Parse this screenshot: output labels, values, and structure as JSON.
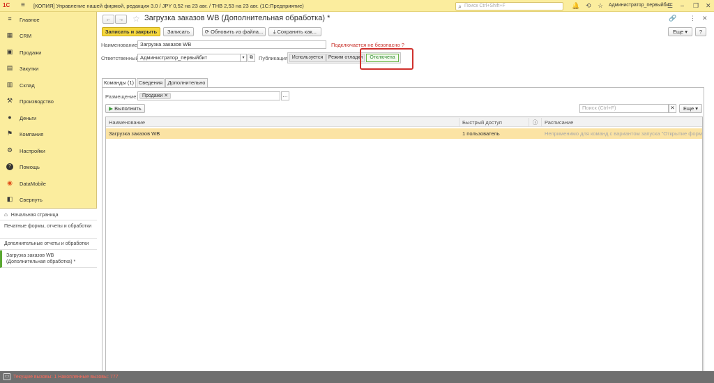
{
  "app": {
    "window_title": "[КОПИЯ] Управление нашей фирмой, редакция 3.0 / JPY 0,52 на 23 авг. / THB 2,53 на 23 авг.  (1С:Предприятие)",
    "logo": "1С",
    "search_placeholder": "Поиск Ctrl+Shift+F",
    "user": "Администратор_первыйбит"
  },
  "sidebar": {
    "items": [
      {
        "label": "Главное",
        "icon": "≡"
      },
      {
        "label": "CRM",
        "icon": "▦"
      },
      {
        "label": "Продажи",
        "icon": "🛍"
      },
      {
        "label": "Закупки",
        "icon": "▤"
      },
      {
        "label": "Склад",
        "icon": "▥"
      },
      {
        "label": "Производство",
        "icon": "⚒"
      },
      {
        "label": "Деньги",
        "icon": "●"
      },
      {
        "label": "Компания",
        "icon": "⚑"
      },
      {
        "label": "Настройки",
        "icon": "⚙"
      },
      {
        "label": "Помощь",
        "icon": "?"
      },
      {
        "label": "DataMobile",
        "icon": "◉"
      },
      {
        "label": "Свернуть",
        "icon": "◧"
      }
    ],
    "home_label": "Начальная страница",
    "open_items": [
      "Печатные формы, отчеты и обработки",
      "Дополнительные отчеты и обработки",
      "Загрузка заказов WB (Дополнительная обработка) *"
    ]
  },
  "form": {
    "title": "Загрузка заказов WB (Дополнительная обработка) *",
    "toolbar": {
      "save_close": "Записать и закрыть",
      "save": "Записать",
      "update_from_file": "Обновить из файла...",
      "save_as": "Сохранить как...",
      "more": "Еще",
      "help": "?"
    },
    "name_label": "Наименование:",
    "name_value": "Загрузка заказов WB",
    "unsafe_link": "Подключается не безопасно",
    "unsafe_q": "?",
    "responsible_label": "Ответственный:",
    "responsible_value": "Администратор_первыйбит",
    "publication_label": "Публикация:",
    "publication_options": [
      "Используется",
      "Режим отладки",
      "Отключена"
    ],
    "tabs": [
      "Команды (1)",
      "Сведения",
      "Дополнительно"
    ],
    "placement_label": "Размещение:",
    "placement_tag": "Продажи",
    "run_button": "Выполнить",
    "search_placeholder": "Поиск (Ctrl+F)",
    "more2": "Еще",
    "table": {
      "headers": [
        "Наименование",
        "Быстрый доступ",
        "Расписание"
      ],
      "rows": [
        {
          "name": "Загрузка заказов WB",
          "access": "1 пользователь",
          "schedule": "Неприменимо для команд с вариантом запуска \"Открытие формы\""
        }
      ]
    }
  },
  "status": {
    "text": "Текущие вызовы: 1   Накопленные вызовы: 777"
  },
  "colors": {
    "accent_yellow": "#fbed9e",
    "highlight_red": "#d0312d",
    "selected_green": "#2e8b2e"
  }
}
